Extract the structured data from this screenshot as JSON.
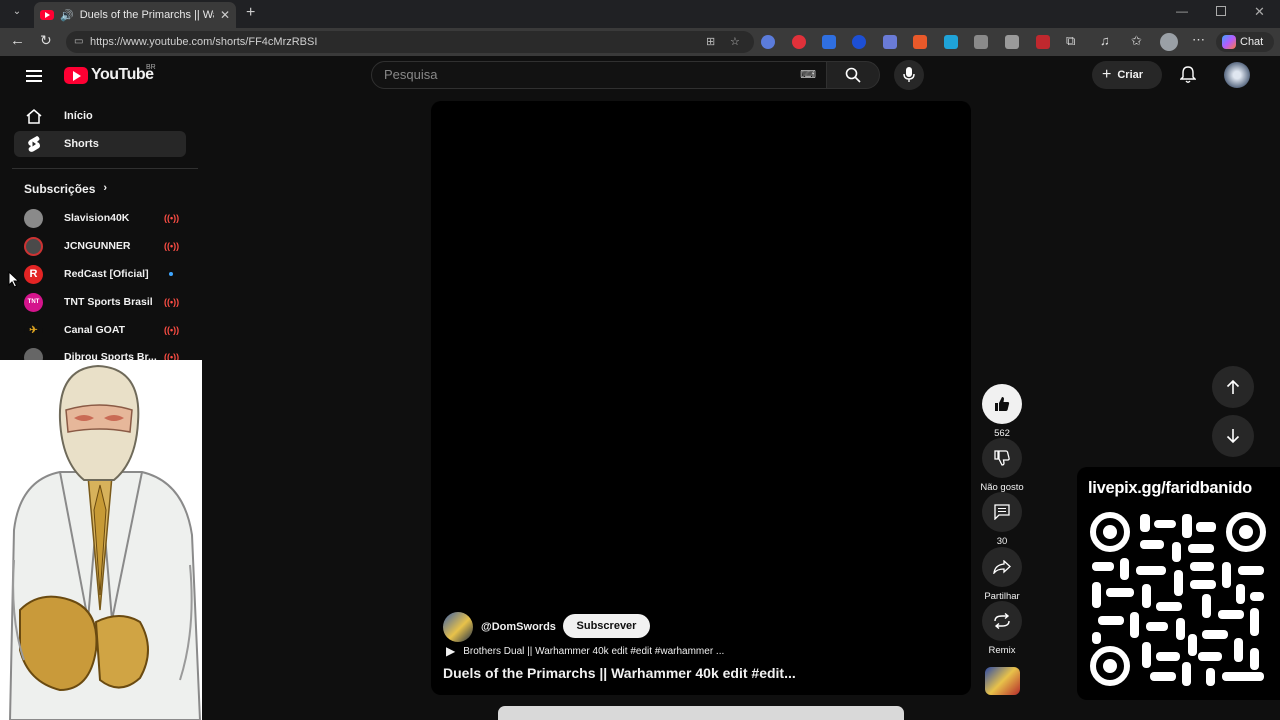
{
  "browser": {
    "tab_title": "Duels of the Primarchs || Warh",
    "url": "https://www.youtube.com/shorts/FF4cMrzRBSI",
    "chat_label": "Chat"
  },
  "header": {
    "logo_text": "YouTube",
    "region": "BR",
    "search_placeholder": "Pesquisa",
    "create_label": "Criar"
  },
  "sidebar": {
    "items": [
      {
        "label": "Início",
        "icon": "home-icon"
      },
      {
        "label": "Shorts",
        "icon": "shorts-icon"
      }
    ],
    "subs_heading": "Subscrições",
    "subscriptions": [
      {
        "name": "Slavision40K",
        "color": "#888888",
        "indicator": "live"
      },
      {
        "name": "JCNGUNNER",
        "color": "#5a5a5a",
        "indicator": "live"
      },
      {
        "name": "RedCast [Oficial]",
        "color": "#e32424",
        "indicator": "new"
      },
      {
        "name": "TNT Sports Brasil",
        "color": "#d4148c",
        "indicator": "live"
      },
      {
        "name": "Canal GOAT",
        "color": "#d8a020",
        "indicator": "live"
      },
      {
        "name": "Dibrou Sports Br...",
        "color": "#666666",
        "indicator": "live"
      }
    ]
  },
  "short": {
    "channel": "@DomSwords",
    "subscribe_label": "Subscrever",
    "music": "Brothers Dual || Warhammer 40k edit #edit #warhammer ...",
    "title": "Duels of the Primarchs || Warhammer 40k edit #edit..."
  },
  "actions": {
    "likes": "562",
    "dislike_label": "Não gosto",
    "comments": "30",
    "share_label": "Partilhar",
    "remix_label": "Remix"
  },
  "overlay": {
    "qr_url": "livepix.gg/faridbanido"
  },
  "colors": {
    "accent": "#ff0033",
    "background": "#0f0f0f",
    "live_indicator": "#ff4e45",
    "new_indicator": "#3ea6ff"
  }
}
